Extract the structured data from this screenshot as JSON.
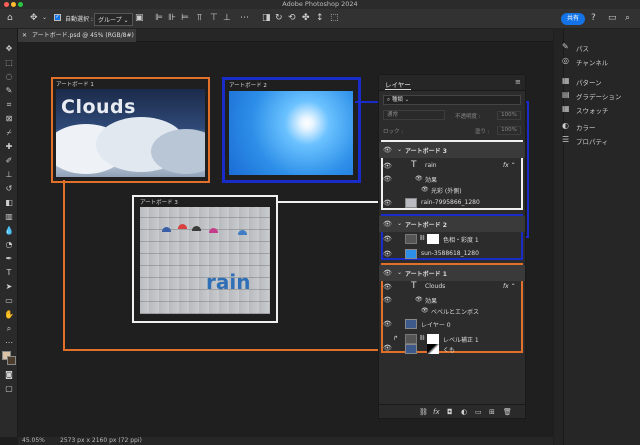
{
  "app": {
    "title": "Adobe Photoshop 2024"
  },
  "options": {
    "auto_select_label": "自動選択 :",
    "group_value": "グループ",
    "share_label": "共有"
  },
  "doc": {
    "tab_title": "アートボード.psd @ 45% (RGB/8#) *"
  },
  "canvas": {
    "artboard1_label": "アートボード 1",
    "artboard2_label": "アートボード 2",
    "artboard3_label": "アートボード 3",
    "clouds_text": "Clouds",
    "rain_text": "rain"
  },
  "panels": {
    "items": [
      "パス",
      "チャンネル",
      "パターン",
      "グラデーション",
      "スウォッチ",
      "カラー",
      "プロパティ"
    ]
  },
  "layers": {
    "tab": "レイヤー",
    "kind": "種類",
    "blend": "通常",
    "opacity_label": "不透明度 :",
    "opacity_value": "100%",
    "lock_label": "ロック :",
    "fill_label": "塗り :",
    "fill_value": "100%",
    "group3": "アートボード 3",
    "rain": "rain",
    "effect": "効果",
    "outer_glow": "光彩 (外側)",
    "rain_img": "rain-7995866_1280",
    "group2": "アートボード 2",
    "hue_sat": "色相・彩度 1",
    "sun_img": "sun-3588618_1280",
    "group1": "アートボード 1",
    "clouds": "Clouds",
    "effect2": "効果",
    "bevel": "ベベルとエンボス",
    "layer0": "レイヤー 0",
    "levels": "レベル補正 1",
    "kumo": "くも"
  },
  "status": {
    "zoom": "45.05%",
    "size": "2573 px x 2160 px (72 ppi)"
  },
  "colors": {
    "orange": "#e0702a",
    "blue": "#1a2cc8",
    "white": "#f0f0f0",
    "accent": "#1473e6"
  }
}
